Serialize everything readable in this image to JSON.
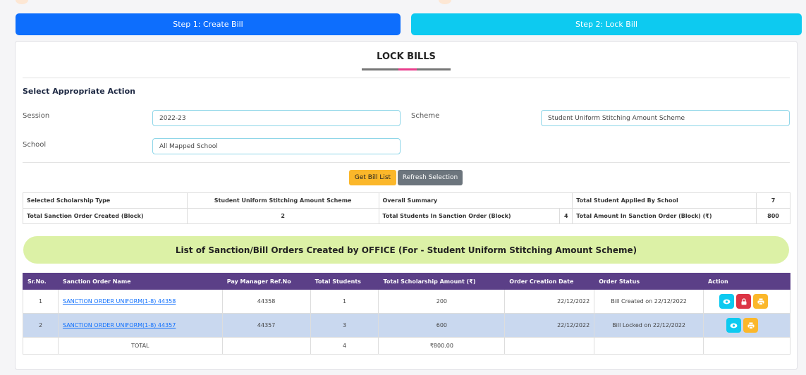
{
  "steps": {
    "step1": "Step 1: Create Bill",
    "step2": "Step 2: Lock Bill"
  },
  "page": {
    "title": "LOCK BILLS",
    "section": "Select Appropriate Action"
  },
  "form": {
    "session_label": "Session",
    "session_value": "2022-23",
    "scheme_label": "Scheme",
    "scheme_value": "Student Uniform Stitching Amount Scheme",
    "school_label": "School",
    "school_value": "All Mapped School"
  },
  "buttons": {
    "get": "Get Bill List",
    "refresh": "Refresh Selection"
  },
  "summary": {
    "r1c1": "Selected Scholarship Type",
    "r1c2": "Student Uniform Stitching Amount Scheme",
    "r1c3": "Overall Summary",
    "r1c5": "Total Student Applied By School",
    "r1c6": "7",
    "r2c1": "Total Sanction Order Created (Block)",
    "r2c2": "2",
    "r2c3": "Total Students In Sanction Order (Block)",
    "r2c4": "4",
    "r2c5": "Total Amount In Sanction Order (Block) (₹)",
    "r2c6": "800"
  },
  "banner": "List of Sanction/Bill Orders Created by OFFICE (For - Student Uniform Stitching Amount Scheme)",
  "table": {
    "headers": [
      "Sr.No.",
      "Sanction Order Name",
      "Pay Manager Ref.No",
      "Total Students",
      "Total Scholarship Amount (₹)",
      "Order Creation Date",
      "Order Status",
      "Action"
    ],
    "rows": [
      {
        "sr": "1",
        "name": "SANCTION ORDER UNIFORM(1-8) 44358",
        "ref": "44358",
        "students": "1",
        "amount": "200",
        "date": "22/12/2022",
        "status": "Bill Created on 22/12/2022"
      },
      {
        "sr": "2",
        "name": "SANCTION ORDER UNIFORM(1-8) 44357",
        "ref": "44357",
        "students": "3",
        "amount": "600",
        "date": "22/12/2022",
        "status": "Bill Locked on 22/12/2022"
      }
    ],
    "total": {
      "label": "TOTAL",
      "students": "4",
      "amount": "₹800.00"
    }
  },
  "icons": {
    "view": "eye-icon",
    "lock": "lock-icon",
    "print": "print-icon"
  }
}
